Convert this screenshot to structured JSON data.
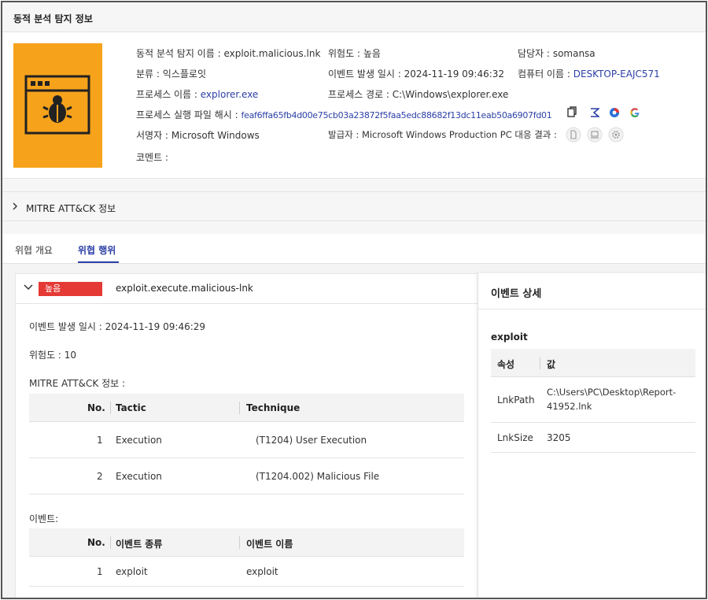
{
  "header": {
    "title": "동적 분석 탐지 정보"
  },
  "info": {
    "detection_name_label": "동적 분석 탐지 이름 :",
    "detection_name": "exploit.malicious.lnk",
    "risk_label": "위험도 :",
    "risk": "높음",
    "owner_label": "담당자 :",
    "owner": "somansa",
    "category_label": "분류 :",
    "category": "익스플로잇",
    "event_time_label": "이벤트 발생 일시 :",
    "event_time": "2024-11-19 09:46:32",
    "computer_label": "컴퓨터 이름 :",
    "computer": "DESKTOP-EAJC571",
    "process_name_label": "프로세스 이름 :",
    "process_name": "explorer.exe",
    "process_path_label": "프로세스 경로 :",
    "process_path": "C:\\Windows\\explorer.exe",
    "hash_label": "프로세스 실행 파일 해시 :",
    "hash": "feaf6ffa65fb4d00e75cb03a23872f5faa5edc88682f13dc11eab50a6907fd01",
    "signer_label": "서명자 :",
    "signer": "Microsoft Windows",
    "issuer_label": "발급자 :",
    "issuer": "Microsoft Windows Production PC",
    "result_label": "대응 결과 :",
    "comment_label": "코멘트 :",
    "icons": [
      "copy-icon",
      "sigma-icon",
      "virustotal-icon",
      "google-icon",
      "file-icon",
      "laptop-icon",
      "gear-icon"
    ],
    "thumb_color": "#f7a21b"
  },
  "mitre_section": {
    "title": "MITRE ATT&CK 정보"
  },
  "tabs": [
    {
      "label": "위협 개요",
      "active": false
    },
    {
      "label": "위협 행위",
      "active": true
    }
  ],
  "behavior": {
    "risk_badge": "높음",
    "badge_color": "#e53935",
    "name": "exploit.execute.malicious-lnk",
    "event_time": "이벤트 발생 일시 : 2024-11-19 09:46:29",
    "risk_score": "위험도 : 10",
    "mitre_label": "MITRE ATT&CK 정보 :",
    "mitre_table": {
      "headers": [
        "No.",
        "Tactic",
        "Technique"
      ],
      "rows": [
        {
          "no": "1",
          "tactic": "Execution",
          "technique": "(T1204) User Execution"
        },
        {
          "no": "2",
          "tactic": "Execution",
          "technique": "(T1204.002) Malicious File"
        }
      ]
    },
    "events_label": "이벤트:",
    "events_table": {
      "headers": [
        "No.",
        "이벤트 종류",
        "이벤트 이름"
      ],
      "rows": [
        {
          "no": "1",
          "type": "exploit",
          "name": "exploit"
        }
      ]
    }
  },
  "event_detail": {
    "title": "이벤트 상세",
    "section": "exploit",
    "headers": [
      "속성",
      "값"
    ],
    "rows": [
      {
        "attr": "LnkPath",
        "value_line1": "C:\\Users\\PC\\Desktop\\Report-",
        "value_line2": "41952.lnk"
      },
      {
        "attr": "LnkSize",
        "value_line1": "3205",
        "value_line2": ""
      }
    ]
  }
}
